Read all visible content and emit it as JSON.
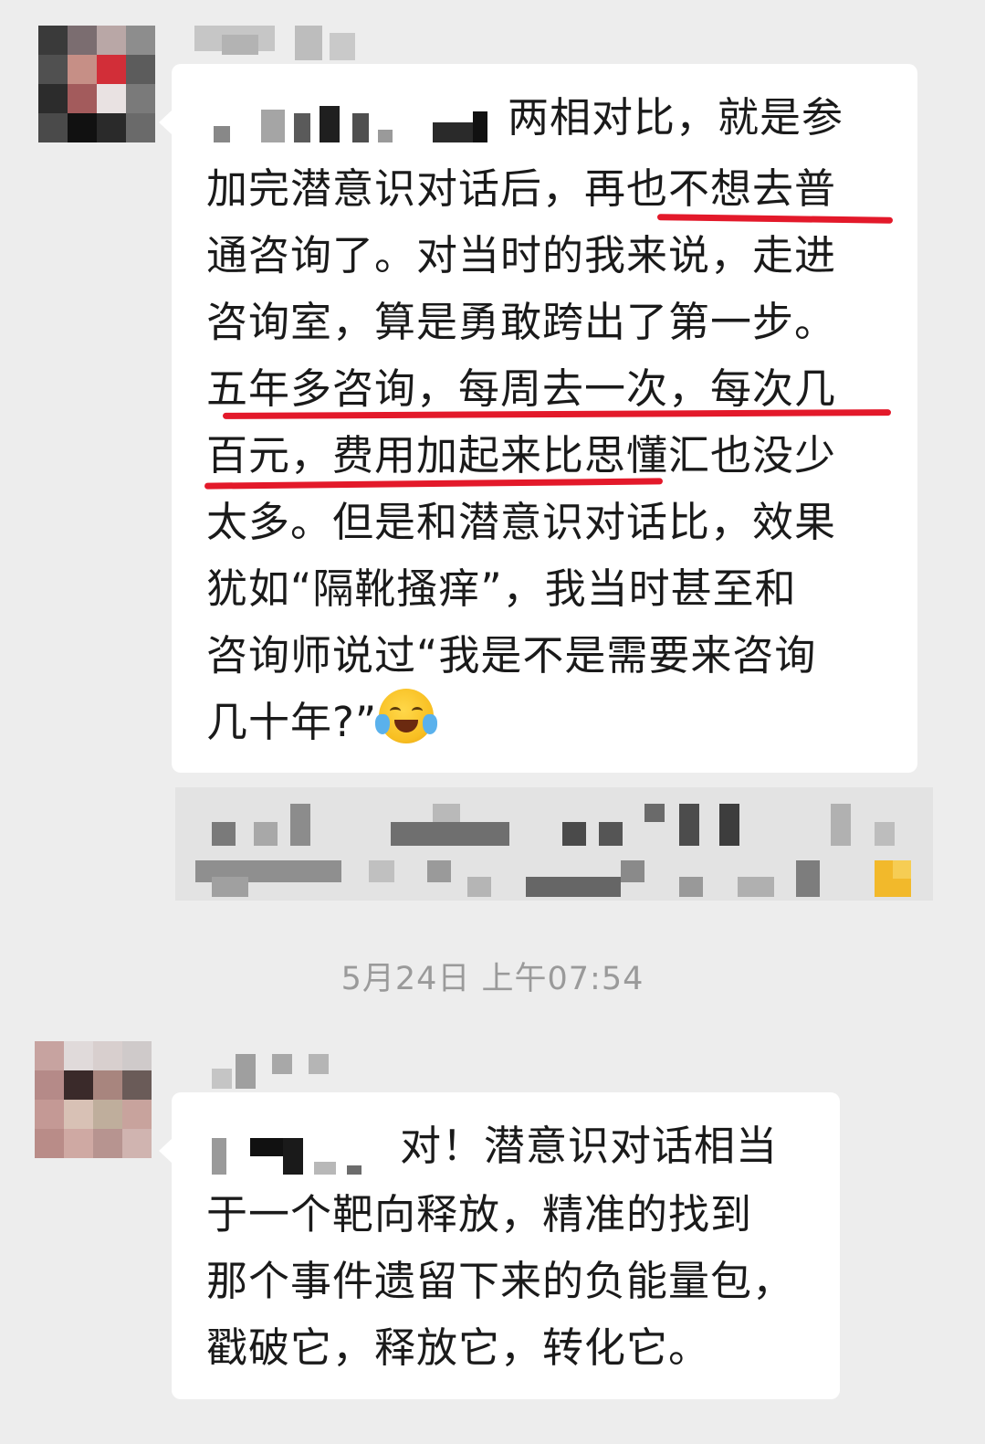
{
  "messages": [
    {
      "lines": [
        "两相对比，就是参",
        "加完潜意识对话后，再也不想去普",
        "通咨询了。对当时的我来说，走进",
        "咨询室，算是勇敢跨出了第一步。",
        "五年多咨询，每周去一次，每次几",
        "百元，费用加起来比思懂汇也没少",
        "太多。但是和潜意识对话比，效果",
        "犹如“隔靴搔痒”，我当时甚至和",
        "咨询师说过“我是不是需要来咨询",
        "几十年?”"
      ],
      "emoji": "laughing-crying-face-icon"
    },
    {
      "lines": [
        "对！潜意识对话相当",
        "于一个靶向释放，精准的找到",
        "那个事件遗留下来的负能量包，",
        "戳破它，释放它，转化它。"
      ]
    }
  ],
  "timestamp": "5月24日 上午07:54",
  "colors": {
    "background": "#ededed",
    "bubble": "#ffffff",
    "text": "#1a1a1a",
    "underline": "#e3192a",
    "timestamp": "#9a9a9a"
  }
}
